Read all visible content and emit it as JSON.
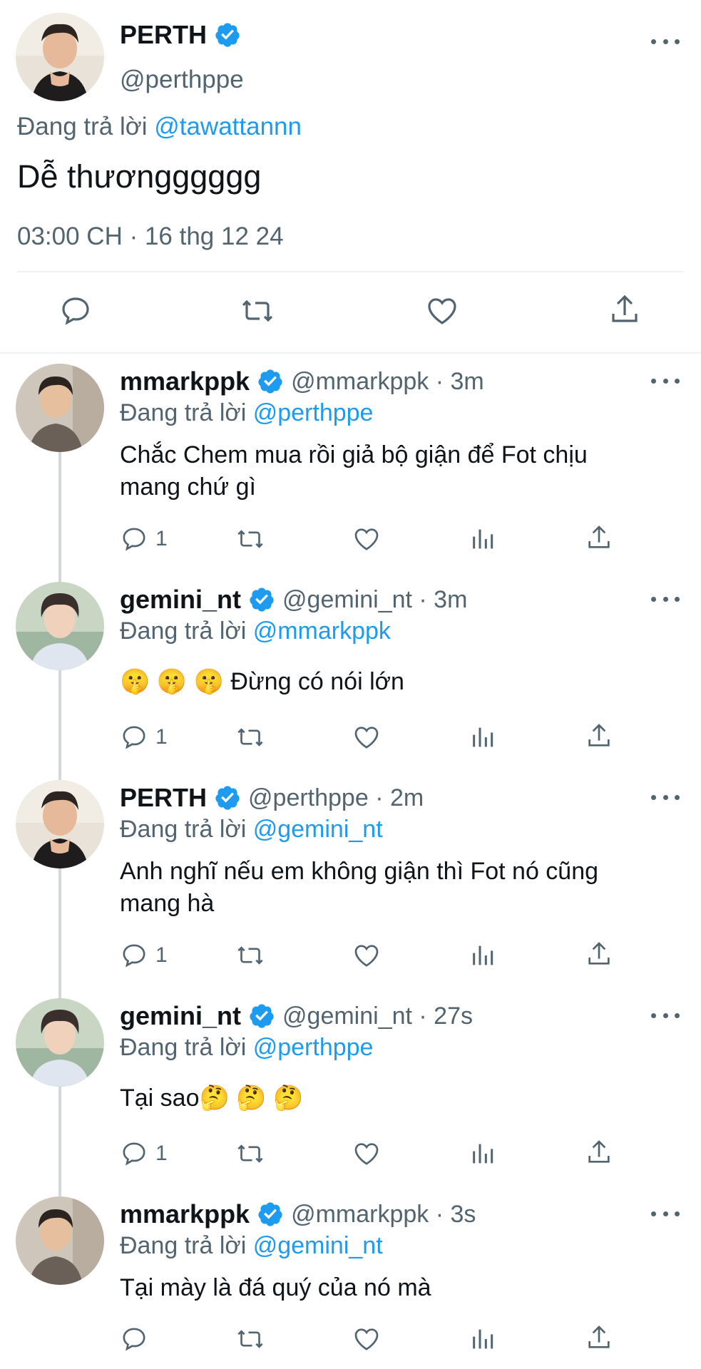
{
  "main_tweet": {
    "author_name": "PERTH",
    "author_handle": "@perthppe",
    "replying_prefix": "Đang trả lời",
    "replying_to": "@tawattannn",
    "text": "Dễ thươngggggg",
    "timestamp": "03:00 CH · 16 thg 12 24"
  },
  "replies": [
    {
      "author_name": "mmarkppk",
      "author_handle": "@mmarkppk · 3m",
      "replying_prefix": "Đang trả lời",
      "replying_to": "@perthppe",
      "text_line1": "Chắc Chem mua rồi giả bộ giận để Fot chịu",
      "text_line2": "mang chứ gì",
      "reply_count": "1"
    },
    {
      "author_name": "gemini_nt",
      "author_handle": "@gemini_nt · 3m",
      "replying_prefix": "Đang trả lời",
      "replying_to": "@mmarkppk",
      "text_line1": "🤫 🤫 🤫 Đừng có nói lớn",
      "text_line2": "",
      "reply_count": "1"
    },
    {
      "author_name": "PERTH",
      "author_handle": "@perthppe · 2m",
      "replying_prefix": "Đang trả lời",
      "replying_to": "@gemini_nt",
      "text_line1": "Anh nghĩ nếu em không giận thì Fot nó cũng",
      "text_line2": "mang hà",
      "reply_count": "1"
    },
    {
      "author_name": "gemini_nt",
      "author_handle": "@gemini_nt · 27s",
      "replying_prefix": "Đang trả lời",
      "replying_to": "@perthppe",
      "text_line1": "Tại sao🤔 🤔 🤔",
      "text_line2": "",
      "reply_count": "1"
    },
    {
      "author_name": "mmarkppk",
      "author_handle": "@mmarkppk · 3s",
      "replying_prefix": "Đang trả lời",
      "replying_to": "@gemini_nt",
      "text_line1": "Tại mày là đá quý của nó mà",
      "text_line2": "",
      "reply_count": ""
    }
  ],
  "colors": {
    "accent": "#1d9bf0",
    "text": "#0f1419",
    "muted": "#536471",
    "divider": "#eff3f4"
  },
  "icons": [
    "reply-icon",
    "retweet-icon",
    "like-icon",
    "share-icon",
    "views-icon",
    "verified-icon",
    "more-icon"
  ]
}
